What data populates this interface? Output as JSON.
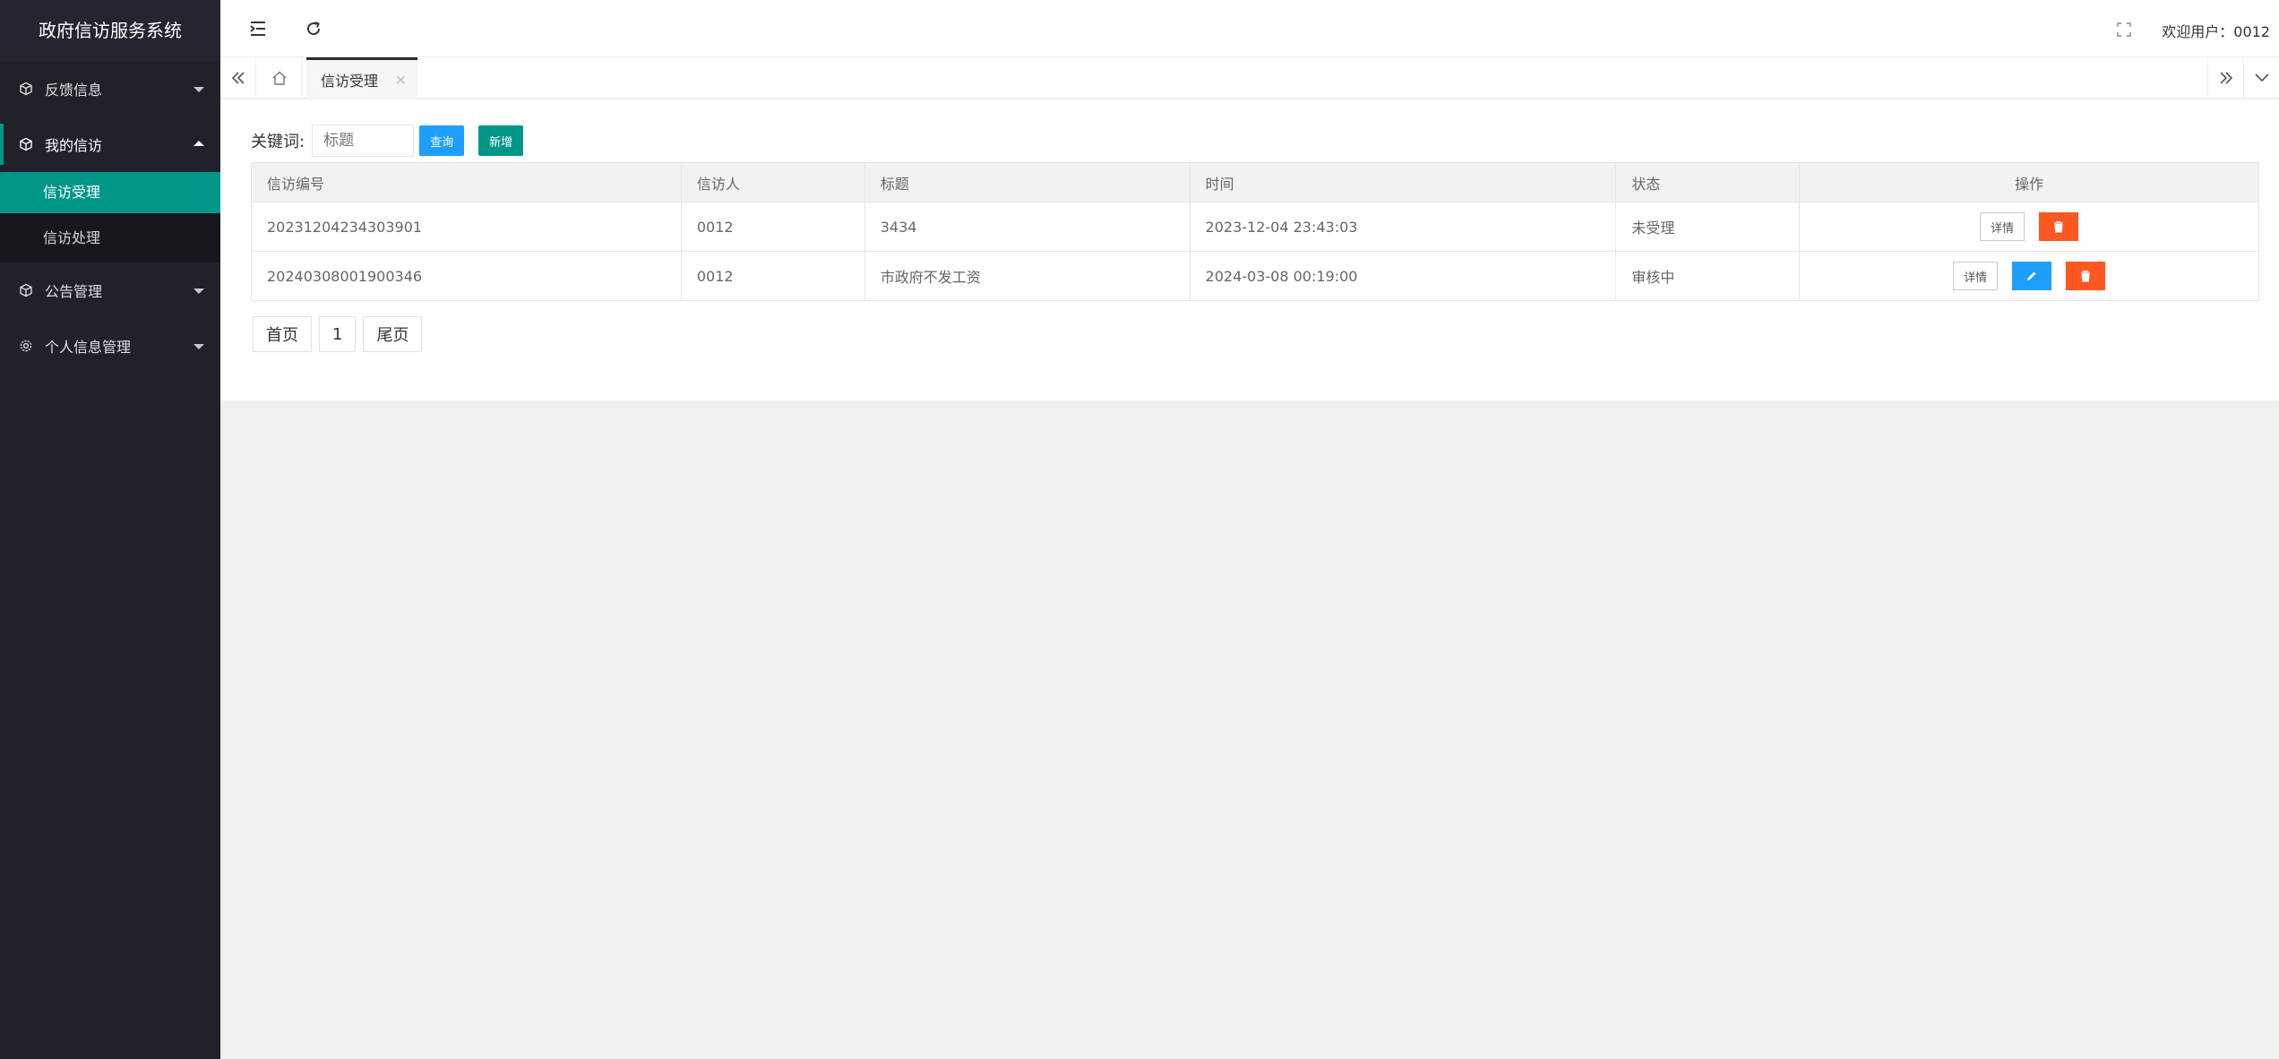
{
  "app": {
    "title": "政府信访服务系统"
  },
  "sidebar": {
    "items": [
      {
        "label": "反馈信息",
        "icon": "cube-icon",
        "expanded": false
      },
      {
        "label": "我的信访",
        "icon": "cube-icon",
        "expanded": true,
        "children": [
          {
            "label": "信访受理",
            "active": true
          },
          {
            "label": "信访处理",
            "active": false
          }
        ]
      },
      {
        "label": "公告管理",
        "icon": "cube-icon",
        "expanded": false
      },
      {
        "label": "个人信息管理",
        "icon": "gear-icon",
        "expanded": false
      }
    ]
  },
  "header": {
    "welcome": "欢迎用户：0012"
  },
  "tabs": [
    {
      "label": "信访受理",
      "close": "×"
    }
  ],
  "search": {
    "label": "关键词:",
    "placeholder": "标题",
    "value": "",
    "search_btn": "查询",
    "add_btn": "新增"
  },
  "table": {
    "columns": [
      "信访编号",
      "信访人",
      "标题",
      "时间",
      "状态",
      "操作"
    ],
    "rows": [
      {
        "id": "20231204234303901",
        "person": "0012",
        "title": "3434",
        "time": "2023-12-04 23:43:03",
        "status": "未受理",
        "status_color": "#0000ff",
        "detail": "详情"
      },
      {
        "id": "20240308001900346",
        "person": "0012",
        "title": "市政府不发工资",
        "time": "2024-03-08 00:19:00",
        "status": "审核中",
        "status_color": "#ff0000",
        "detail": "详情"
      }
    ]
  },
  "pagination": {
    "first": "首页",
    "current": "1",
    "last": "尾页"
  },
  "colors": {
    "sidebar_bg": "#20222a",
    "accent": "#009688",
    "blue": "#1e9fff",
    "danger": "#ff5722"
  }
}
